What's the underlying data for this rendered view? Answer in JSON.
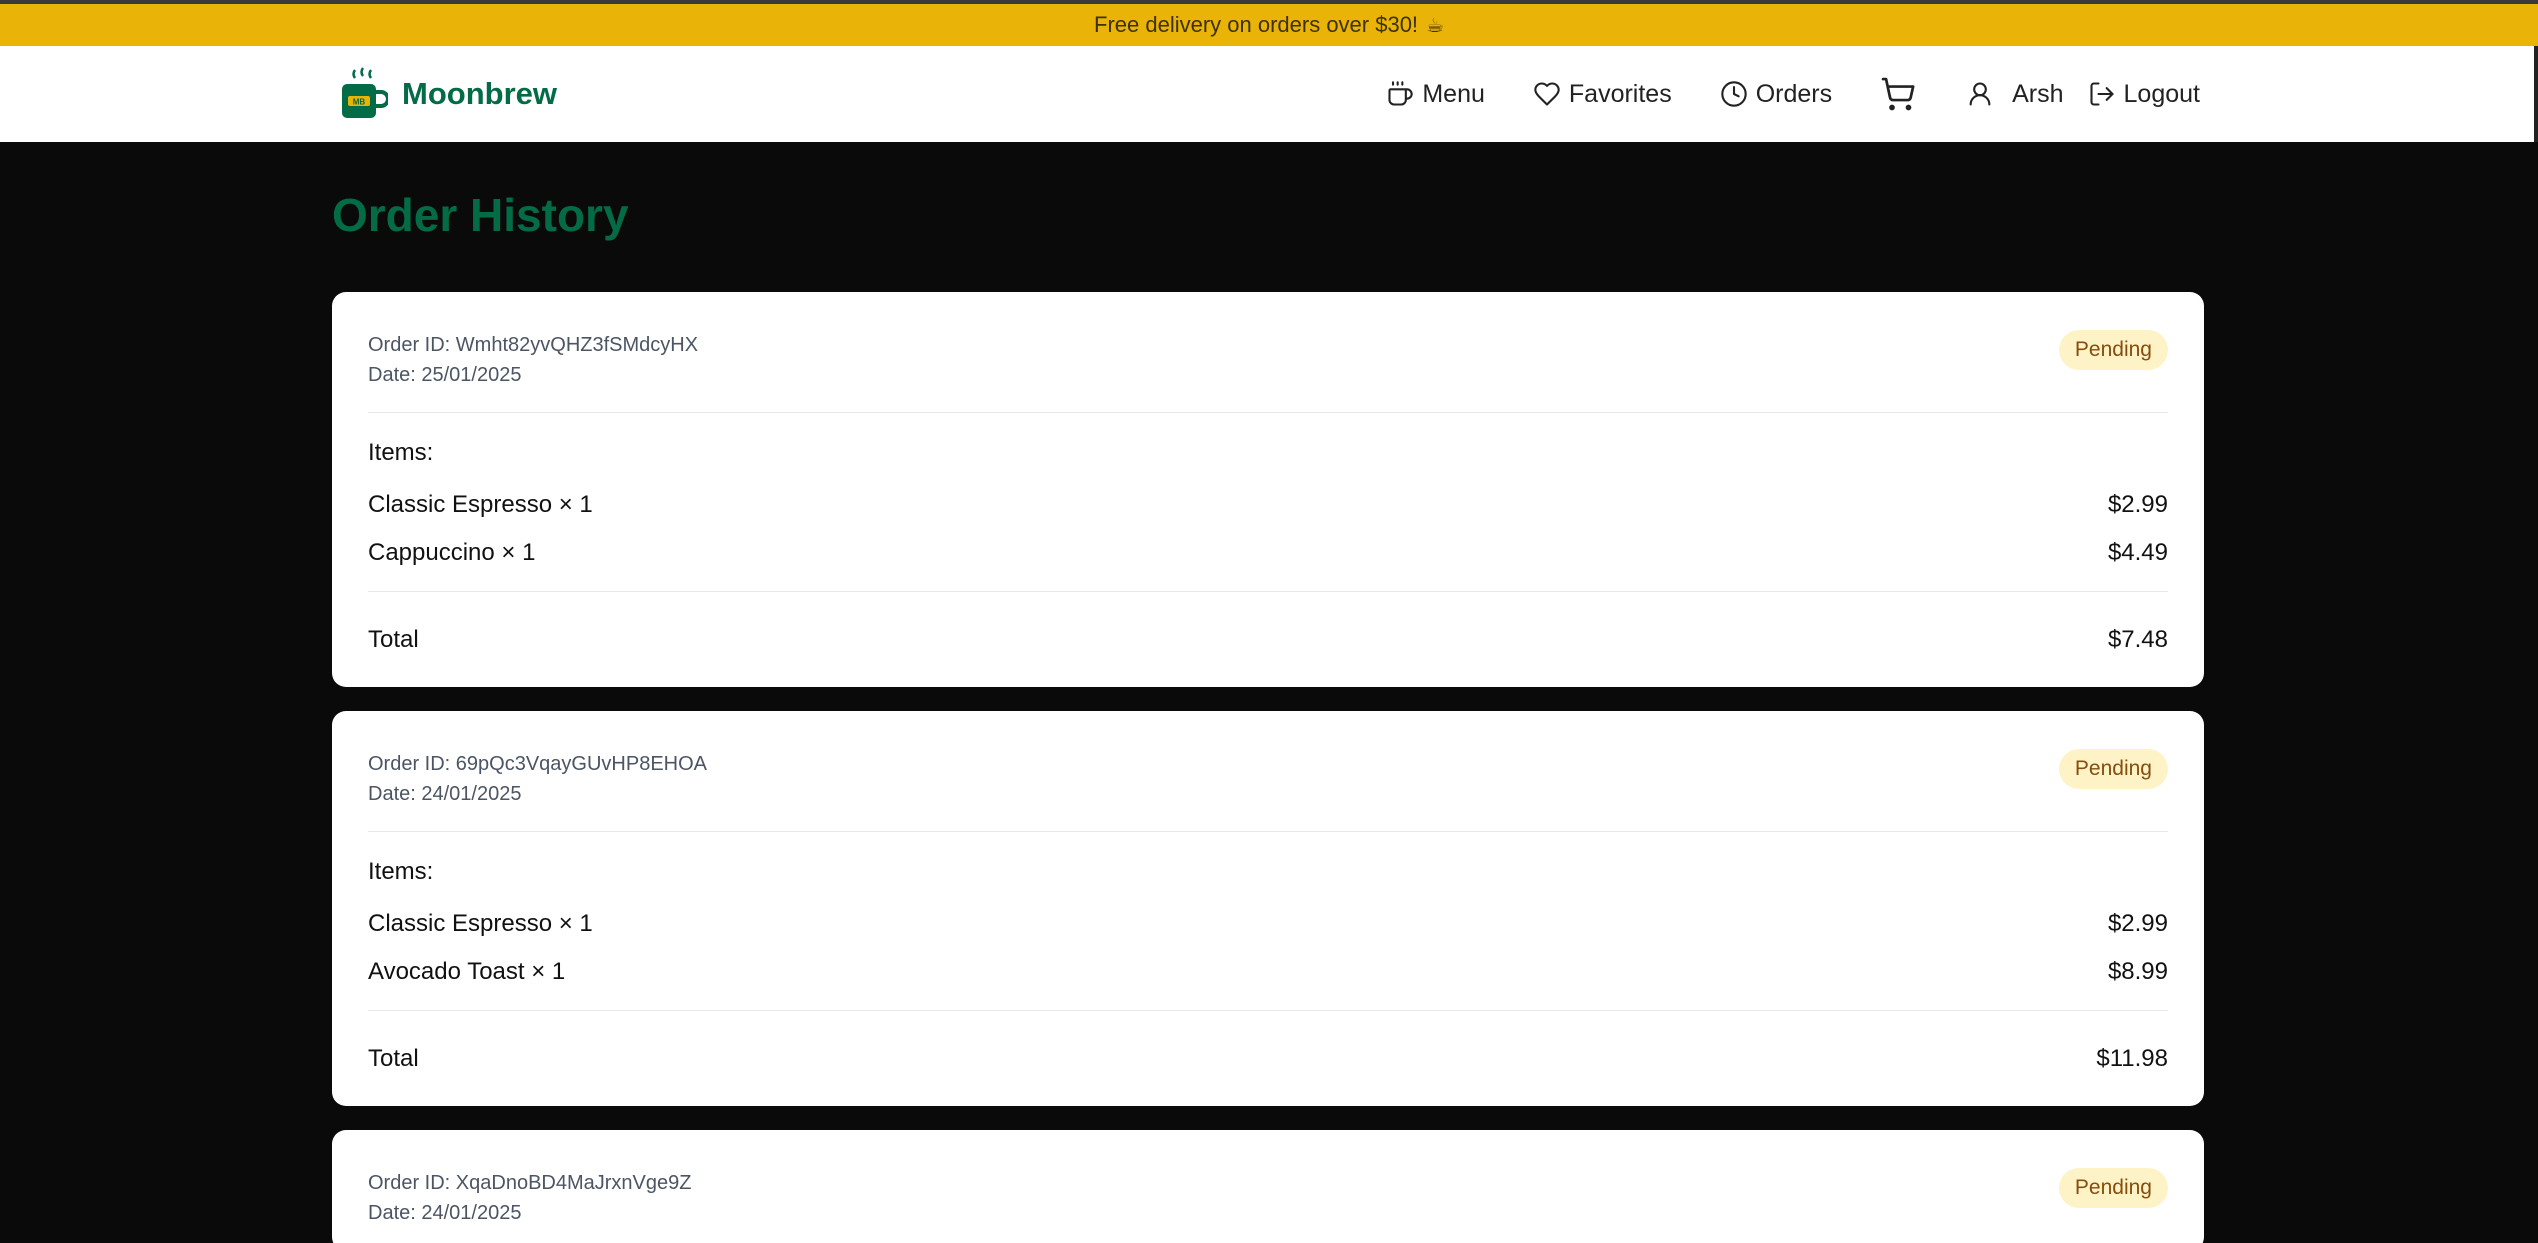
{
  "banner": {
    "text": "Free delivery on orders over $30!",
    "emoji": "☕"
  },
  "brand": {
    "name": "Moonbrew",
    "logo_text": "MB"
  },
  "nav": {
    "menu": "Menu",
    "favorites": "Favorites",
    "orders": "Orders",
    "user": "Arsh",
    "logout": "Logout"
  },
  "page": {
    "title": "Order History"
  },
  "orders": [
    {
      "id_label": "Order ID: Wmht82yvQHZ3fSMdcyHX",
      "date_label": "Date: 25/01/2025",
      "status": "Pending",
      "items_label": "Items:",
      "items": [
        {
          "name": "Classic Espresso × 1",
          "price": "$2.99"
        },
        {
          "name": "Cappuccino × 1",
          "price": "$4.49"
        }
      ],
      "total_label": "Total",
      "total": "$7.48"
    },
    {
      "id_label": "Order ID: 69pQc3VqayGUvHP8EHOA",
      "date_label": "Date: 24/01/2025",
      "status": "Pending",
      "items_label": "Items:",
      "items": [
        {
          "name": "Classic Espresso × 1",
          "price": "$2.99"
        },
        {
          "name": "Avocado Toast × 1",
          "price": "$8.99"
        }
      ],
      "total_label": "Total",
      "total": "$11.98"
    },
    {
      "id_label": "Order ID: XqaDnoBD4MaJrxnVge9Z",
      "date_label": "Date: 24/01/2025",
      "status": "Pending"
    }
  ],
  "colors": {
    "brand_green": "#036b45",
    "banner_yellow": "#eab308",
    "badge_bg": "#fef3c7",
    "page_bg": "#0a0a0a"
  }
}
